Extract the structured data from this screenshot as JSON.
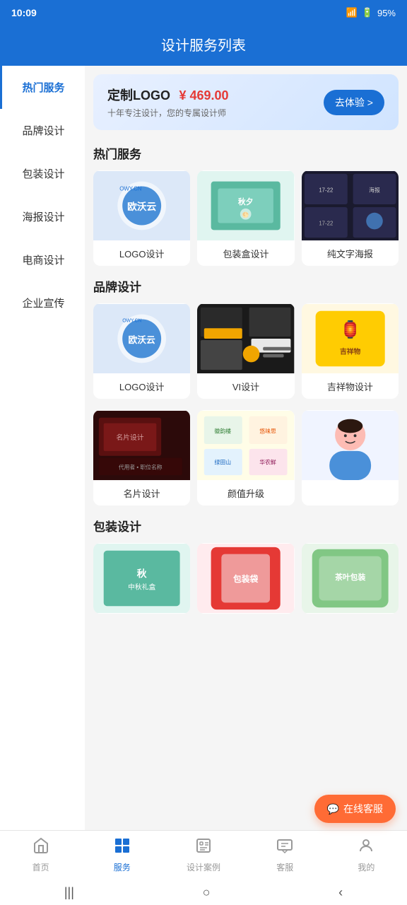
{
  "statusBar": {
    "time": "10:09",
    "battery": "95%"
  },
  "header": {
    "title": "设计服务列表"
  },
  "sidebar": {
    "items": [
      {
        "id": "hot",
        "label": "热门服务",
        "active": true
      },
      {
        "id": "brand",
        "label": "品牌设计",
        "active": false
      },
      {
        "id": "package",
        "label": "包装设计",
        "active": false
      },
      {
        "id": "poster",
        "label": "海报设计",
        "active": false
      },
      {
        "id": "ecom",
        "label": "电商设计",
        "active": false
      },
      {
        "id": "corp",
        "label": "企业宣传",
        "active": false
      }
    ]
  },
  "banner": {
    "title": "定制LOGO",
    "price": "¥ 469.00",
    "subtitle": "十年专注设计，您的专属设计师",
    "button": "去体验 >"
  },
  "sections": [
    {
      "id": "hot",
      "title": "热门服务",
      "items": [
        {
          "id": "logo",
          "label": "LOGO设计",
          "imgType": "logo"
        },
        {
          "id": "box",
          "label": "包装盒设计",
          "imgType": "package-box"
        },
        {
          "id": "poster-text",
          "label": "纯文字海报",
          "imgType": "poster-text"
        }
      ]
    },
    {
      "id": "brand",
      "title": "品牌设计",
      "items": [
        {
          "id": "logo2",
          "label": "LOGO设计",
          "imgType": "logo"
        },
        {
          "id": "vi",
          "label": "VI设计",
          "imgType": "vi"
        },
        {
          "id": "lucky",
          "label": "吉祥物设计",
          "imgType": "lucky"
        },
        {
          "id": "namecard",
          "label": "名片设计",
          "imgType": "namecard"
        },
        {
          "id": "value",
          "label": "颜值升级",
          "imgType": "value"
        },
        {
          "id": "empty",
          "label": "",
          "imgType": "avatar"
        }
      ]
    },
    {
      "id": "package-section",
      "title": "包装设计",
      "items": [
        {
          "id": "pkg1",
          "label": "",
          "imgType": "pkg-autumn"
        },
        {
          "id": "pkg2",
          "label": "",
          "imgType": "pkg-red"
        },
        {
          "id": "pkg3",
          "label": "",
          "imgType": "pkg-green"
        }
      ]
    }
  ],
  "floatService": {
    "label": "在线客服"
  },
  "bottomNav": {
    "items": [
      {
        "id": "home",
        "icon": "🏠",
        "label": "首页",
        "active": false
      },
      {
        "id": "service",
        "icon": "⊞",
        "label": "服务",
        "active": true
      },
      {
        "id": "cases",
        "icon": "📋",
        "label": "设计案例",
        "active": false
      },
      {
        "id": "customer",
        "icon": "💬",
        "label": "客服",
        "active": false
      },
      {
        "id": "mine",
        "icon": "😊",
        "label": "我的",
        "active": false
      }
    ]
  },
  "deviceNav": {
    "back": "‹",
    "home": "○",
    "menu": "|||"
  }
}
